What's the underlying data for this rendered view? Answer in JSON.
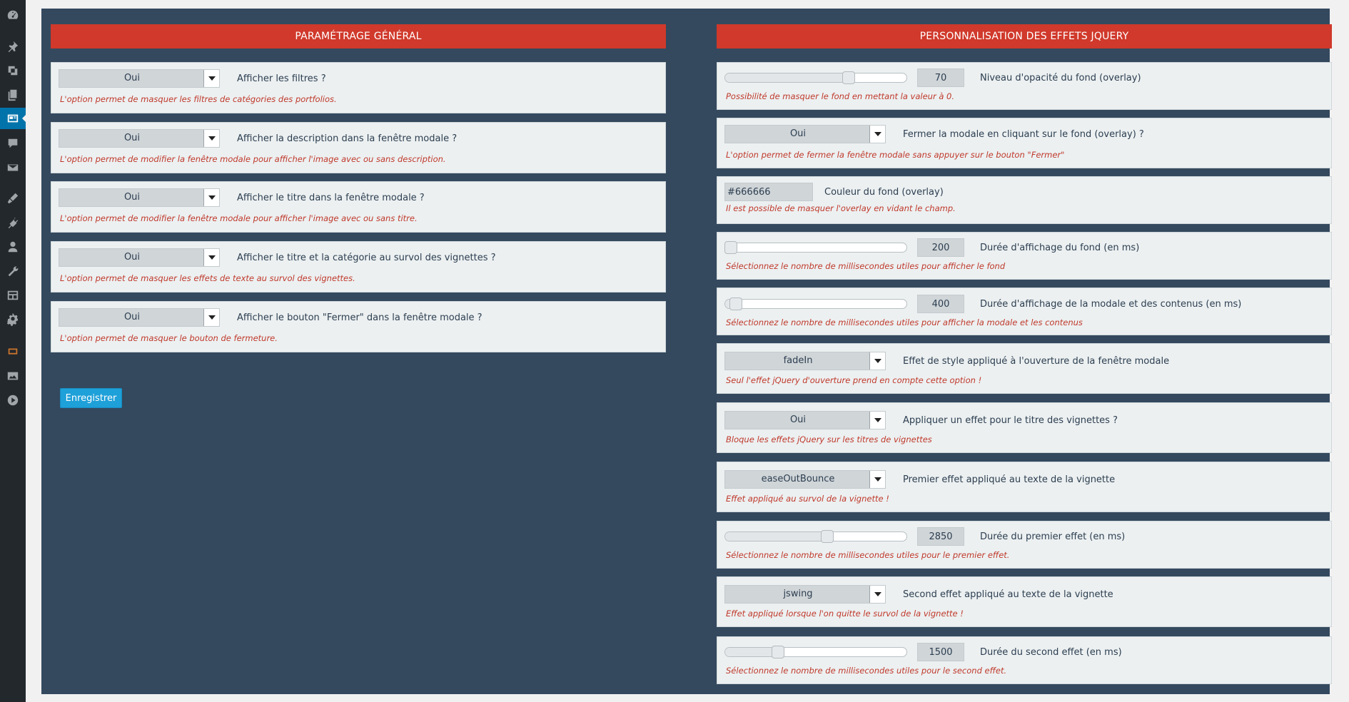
{
  "sidebar": {
    "icons": [
      "dashboard-icon",
      "pin-icon",
      "media-icon",
      "pages-icon",
      "portfolio-icon",
      "comments-icon",
      "mail-icon",
      "appearance-icon",
      "plugins-icon",
      "users-icon",
      "tools-icon",
      "layout-icon",
      "settings-icon",
      "slides-icon",
      "gallery-icon",
      "play-icon"
    ],
    "active_index": 4
  },
  "left": {
    "header": "PARAMÉTRAGE GÉNÉRAL",
    "options": [
      {
        "value": "Oui",
        "label": "Afficher les filtres ?",
        "help": "L'option permet de masquer les filtres de catégories des portfolios."
      },
      {
        "value": "Oui",
        "label": "Afficher la description dans la fenêtre modale ?",
        "help": "L'option permet de modifier la fenêtre modale pour afficher l'image avec ou sans description."
      },
      {
        "value": "Oui",
        "label": "Afficher le titre dans la fenêtre modale ?",
        "help": "L'option permet de modifier la fenêtre modale pour afficher l'image avec ou sans titre."
      },
      {
        "value": "Oui",
        "label": "Afficher le titre et la catégorie au survol des vignettes ?",
        "help": "L'option permet de masquer les effets de texte au survol des vignettes."
      },
      {
        "value": "Oui",
        "label": "Afficher le bouton \"Fermer\" dans la fenêtre modale ?",
        "help": "L'option permet de masquer le bouton de fermeture."
      }
    ],
    "save_label": "Enregistrer"
  },
  "right": {
    "header": "PERSONNALISATION DES EFFETS JQUERY",
    "options": [
      {
        "type": "slider",
        "value": "70",
        "level": 0.7,
        "label": "Niveau d'opacité du fond (overlay)",
        "help": "Possibilité de masquer le fond en mettant la valeur à 0."
      },
      {
        "type": "select",
        "value": "Oui",
        "label": "Fermer la modale en cliquant sur le fond (overlay) ?",
        "help": "L'option permet de fermer la fenêtre modale sans appuyer sur le bouton \"Fermer\""
      },
      {
        "type": "color",
        "value": "#666666",
        "label": "Couleur du fond (overlay)",
        "help": "Il est possible de masquer l'overlay en vidant le champ."
      },
      {
        "type": "slider",
        "value": "200",
        "level": 0.0,
        "label": "Durée d'affichage du fond (en ms)",
        "help": "Sélectionnez le nombre de millisecondes utiles pour afficher le fond"
      },
      {
        "type": "slider",
        "value": "400",
        "level": 0.03,
        "label": "Durée d'affichage de la modale et des contenus (en ms)",
        "help": "Sélectionnez le nombre de millisecondes utiles pour afficher la modale et les contenus"
      },
      {
        "type": "select",
        "value": "fadeIn",
        "label": "Effet de style appliqué à l'ouverture de la fenêtre modale",
        "help": "Seul l'effet jQuery d'ouverture prend en compte cette option !"
      },
      {
        "type": "select",
        "value": "Oui",
        "label": "Appliquer un effet pour le titre des vignettes ?",
        "help": "Bloque les effets jQuery sur les titres de vignettes"
      },
      {
        "type": "select",
        "value": "easeOutBounce",
        "label": "Premier effet appliqué au texte de la vignette",
        "help": "Effet appliqué au survol de la vignette !"
      },
      {
        "type": "slider",
        "value": "2850",
        "level": 0.57,
        "label": "Durée du premier effet (en ms)",
        "help": "Sélectionnez le nombre de millisecondes utiles pour le premier effet."
      },
      {
        "type": "select",
        "value": "jswing",
        "label": "Second effet appliqué au texte de la vignette",
        "help": "Effet appliqué lorsque l'on quitte le survol de la vignette !"
      },
      {
        "type": "slider",
        "value": "1500",
        "level": 0.28,
        "label": "Durée du second effet (en ms)",
        "help": "Sélectionnez le nombre de millisecondes utiles pour le second effet."
      }
    ]
  },
  "colors": {
    "header_red": "#d0392b",
    "panel_bg": "#34495e",
    "card_bg": "#ecf0f1",
    "help_red": "#c0392b",
    "save_blue": "#1ea0d9",
    "sidebar_active": "#0073aa"
  }
}
